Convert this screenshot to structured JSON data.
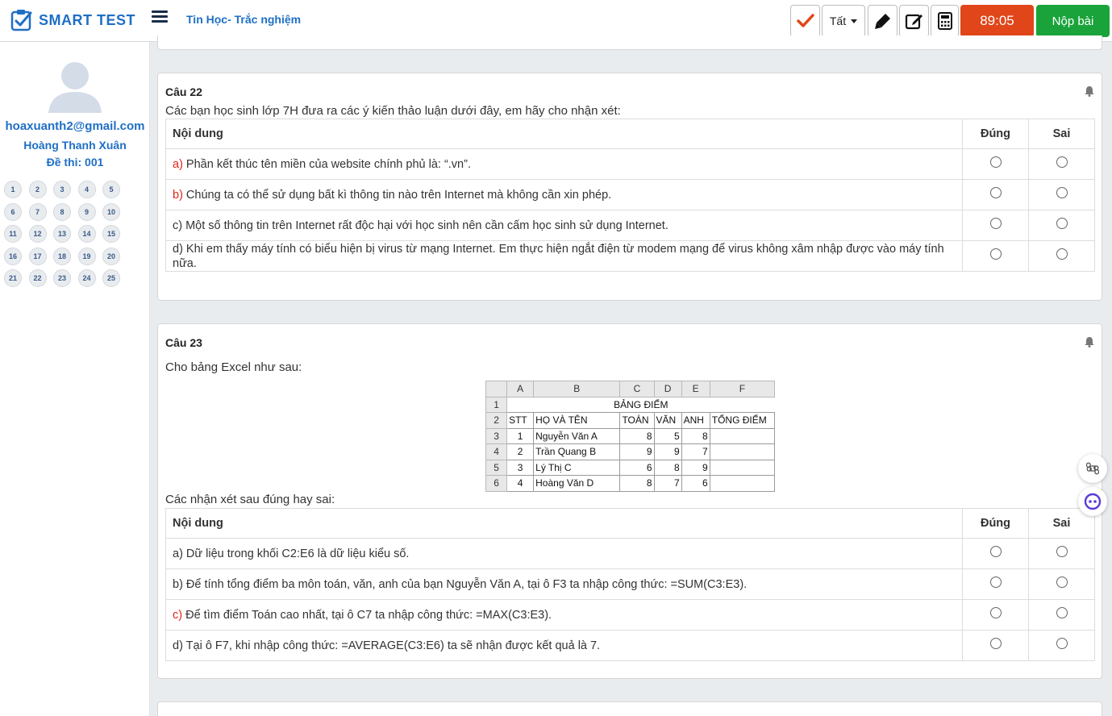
{
  "app": {
    "logo_text": "SMART TEST",
    "course_title": "Tin Học- Trắc nghiệm",
    "filter_label": "Tất",
    "timer": "89:05",
    "submit_label": "Nộp bài"
  },
  "user": {
    "email": "hoaxuanth2@gmail.com",
    "name": "Hoàng Thanh Xuân",
    "exam_code": "Đề thi: 001"
  },
  "question_numbers": [
    "1",
    "2",
    "3",
    "4",
    "5",
    "6",
    "7",
    "8",
    "9",
    "10",
    "11",
    "12",
    "13",
    "14",
    "15",
    "16",
    "17",
    "18",
    "19",
    "20",
    "21",
    "22",
    "23",
    "24",
    "25"
  ],
  "q22": {
    "title": "Câu 22",
    "prompt": "Các bạn học sinh lớp 7H đưa ra các ý kiến thảo luận dưới đây, em hãy cho nhận xét:",
    "header_content": "Nội dung",
    "header_true": "Đúng",
    "header_false": "Sai",
    "items": [
      {
        "mark": "a)",
        "text": " Phần kết thúc tên miền của website chính phủ là: “.vn”."
      },
      {
        "mark": "b)",
        "text": " Chúng ta có thể sử dụng bất kì thông tin nào trên Internet mà không cần xin phép."
      },
      {
        "mark": "",
        "text": "c) Một số thông tin trên Internet rất độc hại với học sinh nên cần cấm học sinh sử dụng Internet."
      },
      {
        "mark": "",
        "text": "d) Khi em thấy máy tính có biểu hiện bị virus từ mạng Internet. Em thực hiện ngắt điện từ modem mạng để virus không xâm nhập được vào máy tính nữa."
      }
    ]
  },
  "q23": {
    "title": "Câu 23",
    "prompt": "Cho bảng Excel như sau:",
    "prompt2": "Các nhận xét sau đúng hay sai:",
    "header_content": "Nội dung",
    "header_true": "Đúng",
    "header_false": "Sai",
    "excel": {
      "col_headers": [
        "A",
        "B",
        "C",
        "D",
        "E",
        "F"
      ],
      "row_numbers": [
        "1",
        "2",
        "3",
        "4",
        "5",
        "6"
      ],
      "table_title": "BẢNG ĐIỂM",
      "header": [
        "STT",
        "HỌ VÀ TÊN",
        "TOÁN",
        "VĂN",
        "ANH",
        "TỔNG ĐIỂM"
      ],
      "rows": [
        [
          "1",
          "Nguyễn Văn A",
          "8",
          "5",
          "8",
          ""
        ],
        [
          "2",
          "Trần Quang B",
          "9",
          "9",
          "7",
          ""
        ],
        [
          "3",
          "Lý Thị C",
          "6",
          "8",
          "9",
          ""
        ],
        [
          "4",
          "Hoàng Văn D",
          "8",
          "7",
          "6",
          ""
        ]
      ]
    },
    "items": [
      {
        "mark": "",
        "text": "a) Dữ liệu trong khối C2:E6 là dữ liệu kiểu số."
      },
      {
        "mark": "",
        "text": "b) Để tính tổng điểm ba môn toán, văn, anh của bạn Nguyễn Văn A, tại ô F3 ta nhập công thức: =SUM(C3:E3)."
      },
      {
        "mark": "c)",
        "text": " Để tìm điểm Toán cao nhất, tại ô C7 ta nhập công thức: =MAX(C3:E3)."
      },
      {
        "mark": "",
        "text": "d) Tại ô F7, khi nhập công thức: =AVERAGE(C3:E6) ta sẽ nhận được kết quả là 7."
      }
    ]
  },
  "colors": {
    "brand": "#1f6fc5",
    "timer_bg": "#e0461a",
    "submit_bg": "#1aa33b",
    "mark": "#e0231a"
  }
}
